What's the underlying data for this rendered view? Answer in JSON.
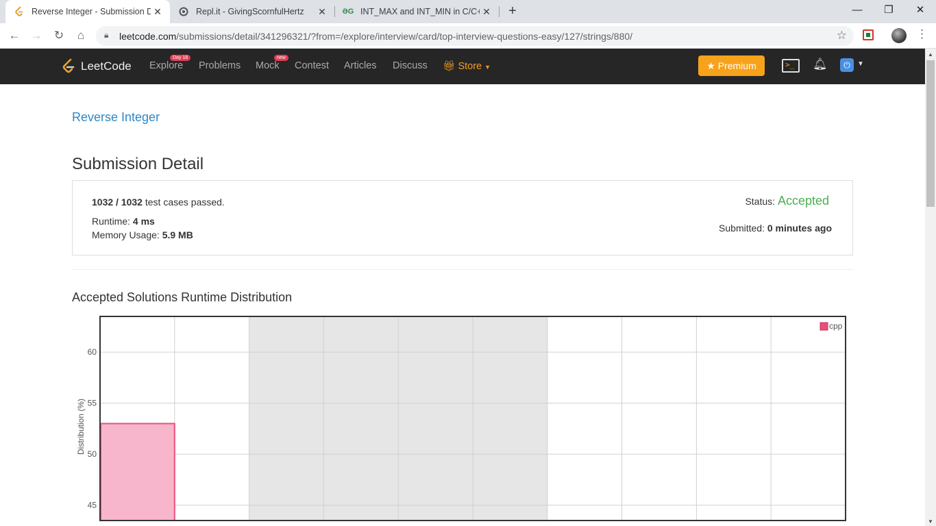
{
  "browser": {
    "tabs": [
      {
        "title": "Reverse Integer - Submission Det",
        "active": true,
        "icon": "leetcode-icon"
      },
      {
        "title": "Repl.it - GivingScornfulHertz",
        "active": false,
        "icon": "replit-icon"
      },
      {
        "title": "INT_MAX and INT_MIN in C/C++",
        "active": false,
        "icon": "gfg-icon"
      }
    ],
    "url_domain": "leetcode.com",
    "url_path": "/submissions/detail/341296321/?from=/explore/interview/card/top-interview-questions-easy/127/strings/880/"
  },
  "navbar": {
    "brand": "LeetCode",
    "links": {
      "explore": "Explore",
      "explore_badge": "Day 18",
      "problems": "Problems",
      "mock": "Mock",
      "mock_badge": "new",
      "contest": "Contest",
      "articles": "Articles",
      "discuss": "Discuss",
      "store": "Store"
    },
    "premium": "Premium"
  },
  "problem_link": "Reverse Integer",
  "page_title": "Submission Detail",
  "detail": {
    "passed": "1032",
    "total": "1032",
    "passed_suffix": "test cases passed.",
    "runtime_label": "Runtime:",
    "runtime_value": "4 ms",
    "memory_label": "Memory Usage:",
    "memory_value": "5.9 MB",
    "status_label": "Status:",
    "status_value": "Accepted",
    "submitted_label": "Submitted:",
    "submitted_value": "0 minutes ago"
  },
  "colors": {
    "accepted": "#4caf50",
    "link": "#2f87c7",
    "premium": "#f7a21b",
    "bar_fill": "#f7b6cc",
    "bar_stroke": "#e8507a"
  },
  "chart_section_title": "Accepted Solutions Runtime Distribution",
  "chart_data": {
    "type": "bar",
    "ylabel": "Distribution (%)",
    "yticks": [
      45,
      50,
      55,
      60
    ],
    "ylim": [
      43.5,
      63.5
    ],
    "grid": true,
    "legend": "top-right",
    "series": [
      {
        "name": "cpp",
        "values": [
          53,
          null,
          null,
          null,
          null,
          null,
          null,
          null,
          null,
          null
        ]
      }
    ],
    "shaded_columns": [
      2,
      3,
      4,
      5
    ]
  }
}
